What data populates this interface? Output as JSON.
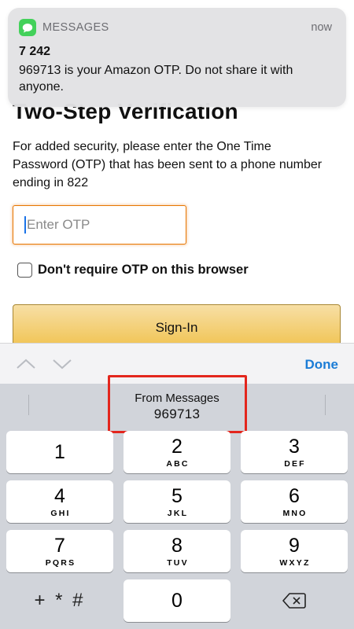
{
  "notification": {
    "app_name": "MESSAGES",
    "time": "now",
    "sender": "7 242",
    "body": "969713 is your Amazon OTP. Do not share it with anyone."
  },
  "page": {
    "title": "Two-Step Verification",
    "description": "For added security, please enter the One Time Password (OTP) that has been sent to a phone number ending in 822",
    "otp_placeholder": "Enter OTP",
    "remember_label": "Don't require OTP on this browser",
    "signin_label": "Sign-In"
  },
  "accessory_bar": {
    "done_label": "Done"
  },
  "keyboard": {
    "suggestion": {
      "label": "From Messages",
      "code": "969713"
    },
    "keys": [
      {
        "digit": "1",
        "letters": ""
      },
      {
        "digit": "2",
        "letters": "ABC"
      },
      {
        "digit": "3",
        "letters": "DEF"
      },
      {
        "digit": "4",
        "letters": "GHI"
      },
      {
        "digit": "5",
        "letters": "JKL"
      },
      {
        "digit": "6",
        "letters": "MNO"
      },
      {
        "digit": "7",
        "letters": "PQRS"
      },
      {
        "digit": "8",
        "letters": "TUV"
      },
      {
        "digit": "9",
        "letters": "WXYZ"
      },
      {
        "digit": "0",
        "letters": ""
      }
    ],
    "symbols_key": "+ * #"
  },
  "colors": {
    "accent_blue": "#1b7cd6",
    "input_focus_orange": "#e77600",
    "signin_yellow": "#f0c14b",
    "highlight_red": "#e3261d",
    "messages_green": "#43d15a"
  }
}
